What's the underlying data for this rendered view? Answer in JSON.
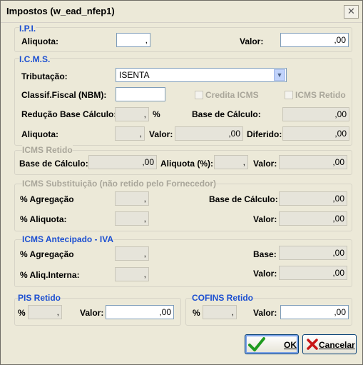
{
  "window": {
    "title": "Impostos (w_ead_nfep1)",
    "close_glyph": "✕"
  },
  "ipi": {
    "group_label": "I.P.I.",
    "aliquota_label": "Aliquota:",
    "aliquota_value": ",",
    "valor_label": "Valor:",
    "valor_value": ",00"
  },
  "icms": {
    "group_label": "I.C.M.S.",
    "tributacao_label": "Tributação:",
    "tributacao_value": "ISENTA",
    "classif_label": "Classif.Fiscal (NBM):",
    "classif_value": "",
    "credita_icms_label": "Credita ICMS",
    "icms_retido_chk_label": "ICMS Retido",
    "reducao_label": "Redução Base Cálculo:",
    "reducao_value": ",",
    "percent_sign": "%",
    "base_label": "Base de Cálculo:",
    "base_value": ",00",
    "aliquota_label": "Aliquota:",
    "aliquota_value": ",",
    "valor_label": "Valor:",
    "valor_value": ",00",
    "diferido_label": "Diferido:",
    "diferido_value": ",00"
  },
  "icms_retido": {
    "group_label": "ICMS Retido",
    "base_label": "Base de Cálculo:",
    "base_value": ",00",
    "aliquota_label": "Aliquota (%):",
    "aliquota_value": ",",
    "valor_label": "Valor:",
    "valor_value": ",00"
  },
  "icms_st": {
    "group_label": "ICMS Substituição (não retido pelo Fornecedor)",
    "agregacao_label": "% Agregação",
    "agregacao_value": ",",
    "base_label": "Base de Cálculo:",
    "base_value": ",00",
    "aliquota_label": "% Aliquota:",
    "aliquota_value": ",",
    "valor_label": "Valor:",
    "valor_value": ",00"
  },
  "icms_antecipado": {
    "group_label": "ICMS Antecipado - IVA",
    "agregacao_label": "% Agregação",
    "agregacao_value": ",",
    "base_label": "Base:",
    "base_value": ",00",
    "aliq_interna_label": "% Aliq.Interna:",
    "aliq_interna_value": ",",
    "valor_label": "Valor:",
    "valor_value": ",00"
  },
  "pis": {
    "group_label": "PIS Retido",
    "percent_label": "%",
    "percent_value": ",",
    "valor_label": "Valor:",
    "valor_value": ",00"
  },
  "cofins": {
    "group_label": "COFINS Retido",
    "percent_label": "%",
    "percent_value": ",",
    "valor_label": "Valor:",
    "valor_value": ",00"
  },
  "buttons": {
    "ok_label": "OK",
    "cancel_label": "Cancelar",
    "ok_color": "#1f9a1f",
    "cancel_color": "#c81515"
  }
}
